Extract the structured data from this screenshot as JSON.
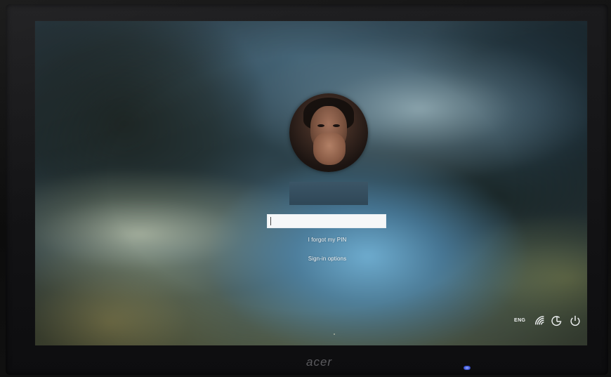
{
  "monitor": {
    "brand": "acer"
  },
  "lock_screen": {
    "username": "",
    "pin_input": {
      "value": "",
      "placeholder": ""
    },
    "forgot_pin_label": "I forgot my PIN",
    "sign_in_options_label": "Sign-in options"
  },
  "system_tray": {
    "language": "ENG",
    "icons": [
      "network-icon",
      "ease-of-access-icon",
      "power-icon"
    ]
  },
  "colors": {
    "pin_field_bg": "#f5f7f8",
    "link_text": "#f2f4f5",
    "power_led": "#3a52d8"
  }
}
